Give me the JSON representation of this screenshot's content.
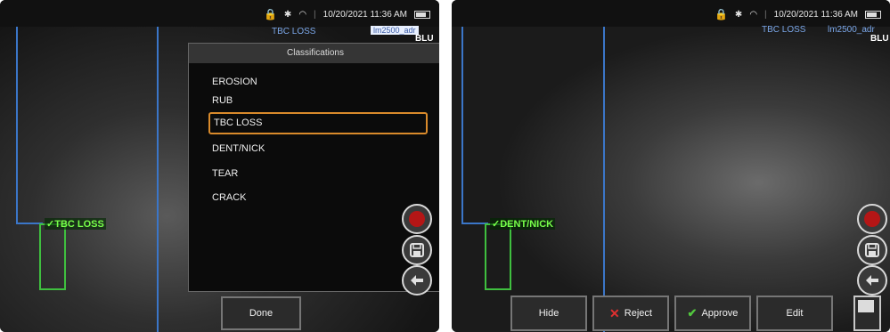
{
  "status": {
    "datetime": "10/20/2021 11:36 AM"
  },
  "left": {
    "hud_label": "TBC LOSS",
    "hud_file": "lm2500_adr",
    "hud_code": "BLU",
    "annotation": "TBC LOSS",
    "classifications": {
      "title": "Classifications",
      "items": [
        "EROSION",
        "RUB",
        "TBC LOSS",
        "DENT/NICK",
        "TEAR",
        "CRACK"
      ],
      "selected": "TBC LOSS"
    },
    "done_label": "Done"
  },
  "right": {
    "hud_label": "TBC LOSS",
    "hud_file": "lm2500_adr",
    "hud_code": "BLU",
    "annotation": "DENT/NICK",
    "buttons": {
      "hide": "Hide",
      "reject": "Reject",
      "approve": "Approve",
      "edit": "Edit"
    }
  },
  "icons": {
    "record": "record-icon",
    "save": "save-icon",
    "back": "arrow-left-icon",
    "lock": "lock-icon",
    "bluetooth": "bluetooth-icon",
    "wifi": "wifi-icon",
    "battery": "battery-icon",
    "reject": "x-icon",
    "approve": "check-icon"
  },
  "colors": {
    "selection": "#d98a2b",
    "annotation": "#78ff4a",
    "record": "#b41616",
    "guide_lines": "#3b76c8"
  }
}
